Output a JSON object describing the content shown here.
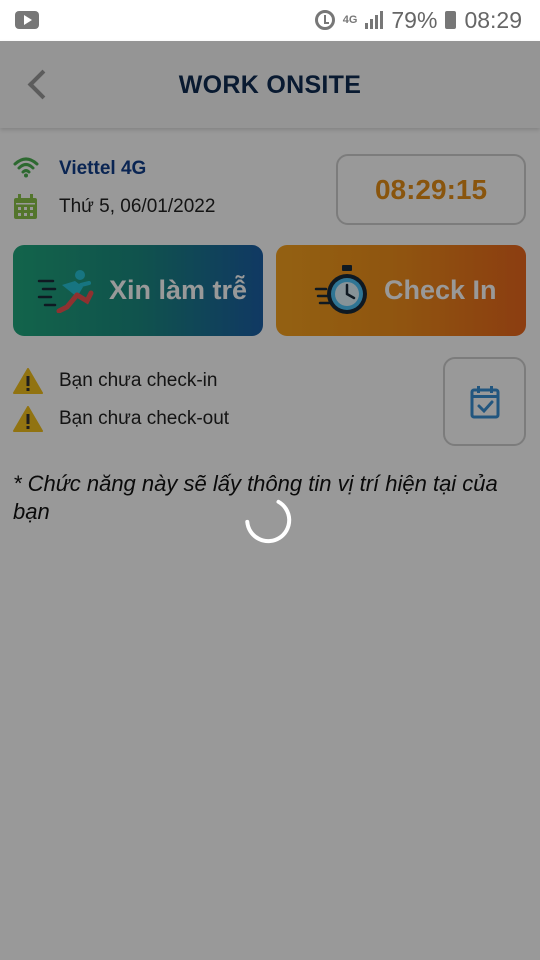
{
  "status_bar": {
    "network": "4G",
    "battery": "79%",
    "time": "08:29",
    "icons": [
      "youtube-icon",
      "alarm-icon",
      "signal-icon",
      "battery-icon"
    ]
  },
  "header": {
    "title": "WORK ONSITE",
    "back_icon": "chevron-left-icon"
  },
  "info": {
    "network_name": "Viettel 4G",
    "date": "Thứ 5, 06/01/2022",
    "clock": "08:29:15"
  },
  "actions": {
    "late_label": "Xin làm trễ",
    "checkin_label": "Check In"
  },
  "status": {
    "checkin_msg": "Bạn chưa check-in",
    "checkout_msg": "Bạn chưa check-out"
  },
  "note": "* Chức năng này sẽ lấy thông tin vị trí hiện tại của bạn",
  "colors": {
    "title": "#0f2c52",
    "network": "#113e8a",
    "clock": "#e58e17",
    "late_button": "#1b8a80",
    "checkin_button": "#f08d1b",
    "warning": "#f2c01d",
    "calendar_icon": "#8bc34a",
    "wifi_icon": "#4caf50"
  }
}
